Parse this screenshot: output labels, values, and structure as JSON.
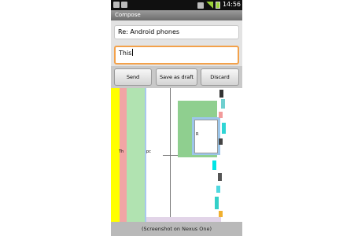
{
  "status_bar": {
    "time": "14:56"
  },
  "title_bar": {
    "title": "Compose"
  },
  "compose": {
    "subject_value": "Re: Android phones",
    "body_value": "This"
  },
  "buttons": {
    "send": "Send",
    "save_draft": "Save as draft",
    "discard": "Discard"
  },
  "visualization": {
    "label_th": "Th",
    "label_pc": "pc",
    "label_r": "R"
  },
  "caption": "(Screenshot on Nexus One)",
  "colors": {
    "focus_border": "#f3a14a",
    "strip_yellow": "#ffff00",
    "strip_pink": "#f1a5a5",
    "strip_green": "#b1e3b1",
    "box_green": "#8fcf8f",
    "box_blue": "#9cc6ea"
  }
}
